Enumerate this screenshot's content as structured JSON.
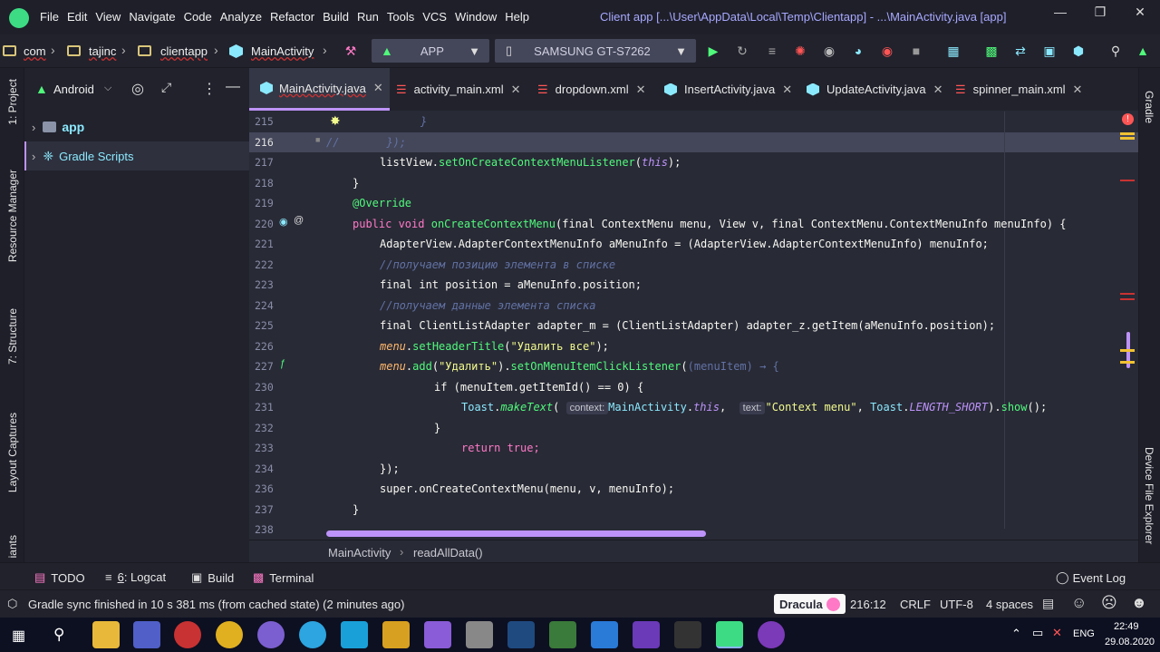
{
  "menubar": {
    "items": [
      "File",
      "Edit",
      "View",
      "Navigate",
      "Code",
      "Analyze",
      "Refactor",
      "Build",
      "Run",
      "Tools",
      "VCS",
      "Window",
      "Help"
    ],
    "window_title": "Client app [...\\User\\AppData\\Local\\Temp\\Clientapp] - ...\\MainActivity.java [app]"
  },
  "toolbar": {
    "breadcrumb": [
      "com",
      "tajinc",
      "clientapp",
      "MainActivity"
    ],
    "config": "APP",
    "device": "SAMSUNG GT-S7262"
  },
  "left_strip": {
    "project": "1: Project",
    "resource": "Resource Manager",
    "structure": "7: Structure",
    "captures": "Layout Captures",
    "variants": "iants"
  },
  "right_strip": {
    "gradle": "Gradle",
    "device_explorer": "Device File Explorer"
  },
  "project_panel": {
    "view_mode": "Android",
    "tree": [
      {
        "label": "app"
      },
      {
        "label": "Gradle Scripts"
      }
    ]
  },
  "tabs": [
    {
      "label": "MainActivity.java",
      "type": "java"
    },
    {
      "label": "activity_main.xml",
      "type": "xml"
    },
    {
      "label": "dropdown.xml",
      "type": "xml"
    },
    {
      "label": "InsertActivity.java",
      "type": "java"
    },
    {
      "label": "UpdateActivity.java",
      "type": "java"
    },
    {
      "label": "spinner_main.xml",
      "type": "xml"
    }
  ],
  "editor": {
    "line_numbers": [
      "215",
      "216",
      "217",
      "218",
      "219",
      "220",
      "221",
      "222",
      "223",
      "224",
      "225",
      "226",
      "227",
      "230",
      "231",
      "232",
      "233",
      "234",
      "236",
      "237",
      "238"
    ],
    "code": {
      "l215": "}",
      "l216": "});",
      "l217a": "listView.",
      "l217b": "setOnCreateContextMenuListener",
      "l217c": "this",
      "l218": "}",
      "l219": "@Override",
      "l220_kw": "public void",
      "l220_fn": "onCreateContextMenu",
      "l220_rest": "(final ContextMenu menu, View v, final ContextMenu.ContextMenuInfo menuInfo) {",
      "l221": "AdapterView.AdapterContextMenuInfo aMenuInfo = (AdapterView.AdapterContextMenuInfo) menuInfo;",
      "l222": "//получаем позицию элемента в списке",
      "l223": "final int position = aMenuInfo.position;",
      "l224": "//получаем данные элемента списка",
      "l225": "final ClientListAdapter adapter_m = (ClientListAdapter) adapter_z.getItem(aMenuInfo.position);",
      "l226_str": "\"Удалить все\"",
      "l227_str": "\"Удалить\"",
      "l227_lambda": "(menuItem) → {",
      "l230": "if (menuItem.getItemId() == 0) {",
      "l231_hint1": "context:",
      "l231_hint2": "text:",
      "l231_str": "\"Context menu\"",
      "l232": "}",
      "l233": "return true;",
      "l234": "});",
      "l236": "super.onCreateContextMenu(menu, v, menuInfo);",
      "l237": "}"
    }
  },
  "breadcrumb_bottom": [
    "MainActivity",
    "readAllData()"
  ],
  "tool_windows": {
    "todo": "TODO",
    "logcat_num": "6",
    "logcat": ": Logcat",
    "build": "Build",
    "terminal": "Terminal",
    "event_log": "Event Log"
  },
  "status": {
    "message": "Gradle sync finished in 10 s 381 ms (from cached state) (2 minutes ago)",
    "theme": "Dracula",
    "position": "216:12",
    "line_sep": "CRLF",
    "encoding": "UTF-8",
    "indent": "4 spaces"
  },
  "taskbar": {
    "lang": "ENG",
    "time": "22:49",
    "date": "29.08.2020"
  },
  "colors": {
    "accent": "#bd93f9",
    "keyword": "#ff79c6",
    "function": "#50fa7b",
    "type": "#8be9fd",
    "string": "#f1fa8c",
    "comment": "#6272a4"
  }
}
